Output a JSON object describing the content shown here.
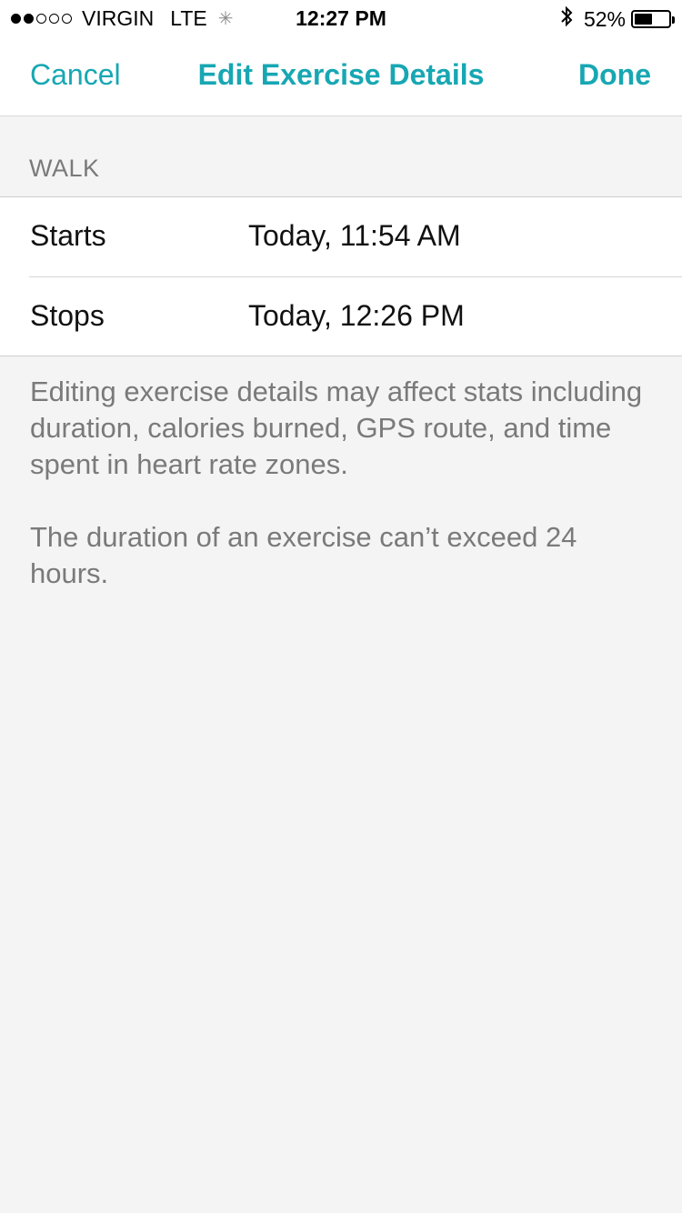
{
  "status_bar": {
    "carrier": "VIRGIN",
    "network": "LTE",
    "time": "12:27 PM",
    "battery_percent": "52%",
    "battery_level": 0.52,
    "signal_bars_filled": 2,
    "signal_bars_total": 5
  },
  "nav": {
    "cancel_label": "Cancel",
    "title": "Edit Exercise Details",
    "done_label": "Done",
    "accent_color": "#17a7b3"
  },
  "section": {
    "header": "WALK"
  },
  "rows": [
    {
      "label": "Starts",
      "value": "Today, 11:54 AM"
    },
    {
      "label": "Stops",
      "value": "Today, 12:26 PM"
    }
  ],
  "notes": [
    "Editing exercise details may affect stats including duration, calories burned, GPS route, and time spent in heart rate zones.",
    "The duration of an exercise can’t exceed 24 hours."
  ]
}
